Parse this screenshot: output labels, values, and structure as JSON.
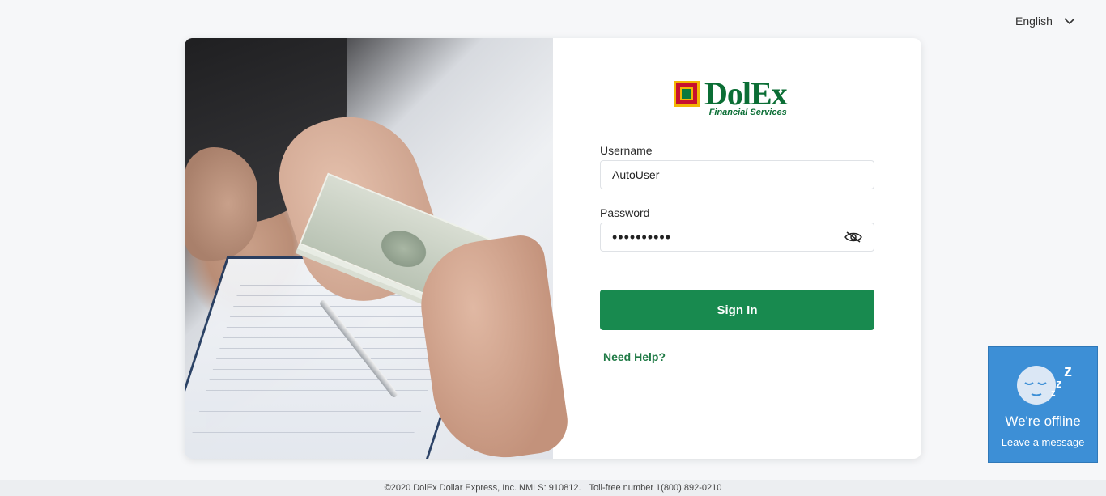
{
  "header": {
    "language": "English"
  },
  "login": {
    "logo_brand": "DolEx",
    "logo_tagline": "Financial Services",
    "username_label": "Username",
    "username_value": "AutoUser",
    "password_label": "Password",
    "password_value": "••••••••••",
    "signin_label": "Sign In",
    "help_label": "Need Help?"
  },
  "footer": {
    "copyright": "©2020 DolEx Dollar Express, Inc. NMLS: 910812.",
    "tollfree": "Toll-free number 1(800) 892-0210"
  },
  "chat": {
    "status": "We're offline",
    "action": "Leave a message"
  },
  "icons": {
    "language_toggle": "chevron-down-icon",
    "password_toggle": "eye-slash-icon",
    "chat_avatar": "sleeping-face-icon"
  },
  "colors": {
    "brand_green": "#0b6e35",
    "button_green": "#188a4f",
    "chat_blue": "#3d8fd6"
  }
}
